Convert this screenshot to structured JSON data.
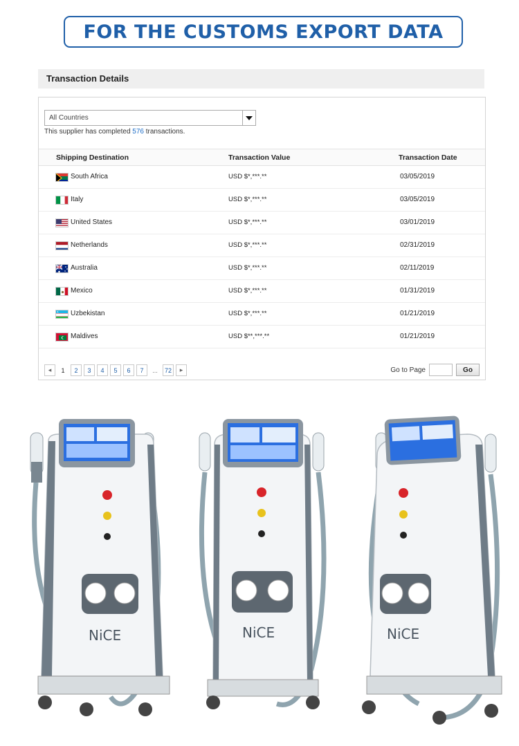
{
  "banner": {
    "title": "FOR THE CUSTOMS EXPORT DATA"
  },
  "panel": {
    "title": "Transaction Details",
    "country_filter": "All Countries",
    "summary_prefix": "This supplier has completed ",
    "summary_count": "576",
    "summary_suffix": " transactions.",
    "columns": [
      "Shipping Destination",
      "Transaction Value",
      "Transaction Date"
    ]
  },
  "transactions": [
    {
      "country": "South Africa",
      "value": "USD $*,***.**",
      "date": "03/05/2019"
    },
    {
      "country": "Italy",
      "value": "USD $*,***.**",
      "date": "03/05/2019"
    },
    {
      "country": "United States",
      "value": "USD $*,***.**",
      "date": "03/01/2019"
    },
    {
      "country": "Netherlands",
      "value": "USD $*,***.**",
      "date": "02/31/2019"
    },
    {
      "country": "Australia",
      "value": "USD $*,***.**",
      "date": "02/11/2019"
    },
    {
      "country": "Mexico",
      "value": "USD $*,***.**",
      "date": "01/31/2019"
    },
    {
      "country": "Uzbekistan",
      "value": "USD $*,***.**",
      "date": "01/21/2019"
    },
    {
      "country": "Maldives",
      "value": "USD $**,***.**",
      "date": "01/21/2019"
    }
  ],
  "pagination": {
    "prev": "◂",
    "pages": [
      "1",
      "2",
      "3",
      "4",
      "5",
      "6",
      "7"
    ],
    "ellipsis": "...",
    "last": "72",
    "next": "▸",
    "goto_label": "Go to Page",
    "go_button": "Go"
  },
  "product": {
    "brand": "NiCE"
  }
}
